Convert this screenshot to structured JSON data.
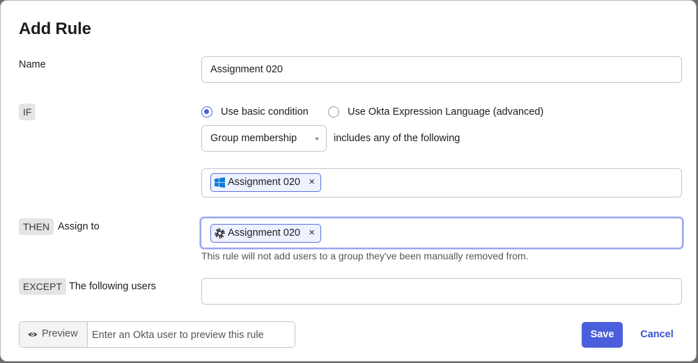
{
  "dialog": {
    "title": "Add Rule"
  },
  "name_row": {
    "label": "Name",
    "value": "Assignment 020"
  },
  "if_row": {
    "tag": "IF",
    "radio_basic": "Use basic condition",
    "radio_advanced": "Use Okta Expression Language (advanced)",
    "selected_mode": "basic",
    "condition_select": "Group membership",
    "condition_text": "includes any of the following",
    "groups": [
      {
        "label": "Assignment 020",
        "icon": "windows-icon",
        "remove": "×"
      }
    ]
  },
  "then_row": {
    "tag": "THEN",
    "label": "Assign to",
    "groups": [
      {
        "label": "Assignment 020",
        "icon": "okta-icon",
        "remove": "×"
      }
    ],
    "hint": "This rule will not add users to a group they've been manually removed from."
  },
  "except_row": {
    "tag": "EXCEPT",
    "label": "The following users",
    "value": ""
  },
  "footer": {
    "preview_label": "Preview",
    "preview_placeholder": "Enter an Okta user to preview this rule",
    "save_label": "Save",
    "cancel_label": "Cancel"
  },
  "colors": {
    "primary": "#4b5fdc",
    "chip_border": "#5a6fe0",
    "chip_bg": "#eef1ff",
    "tag_bg": "#e5e5e5"
  }
}
